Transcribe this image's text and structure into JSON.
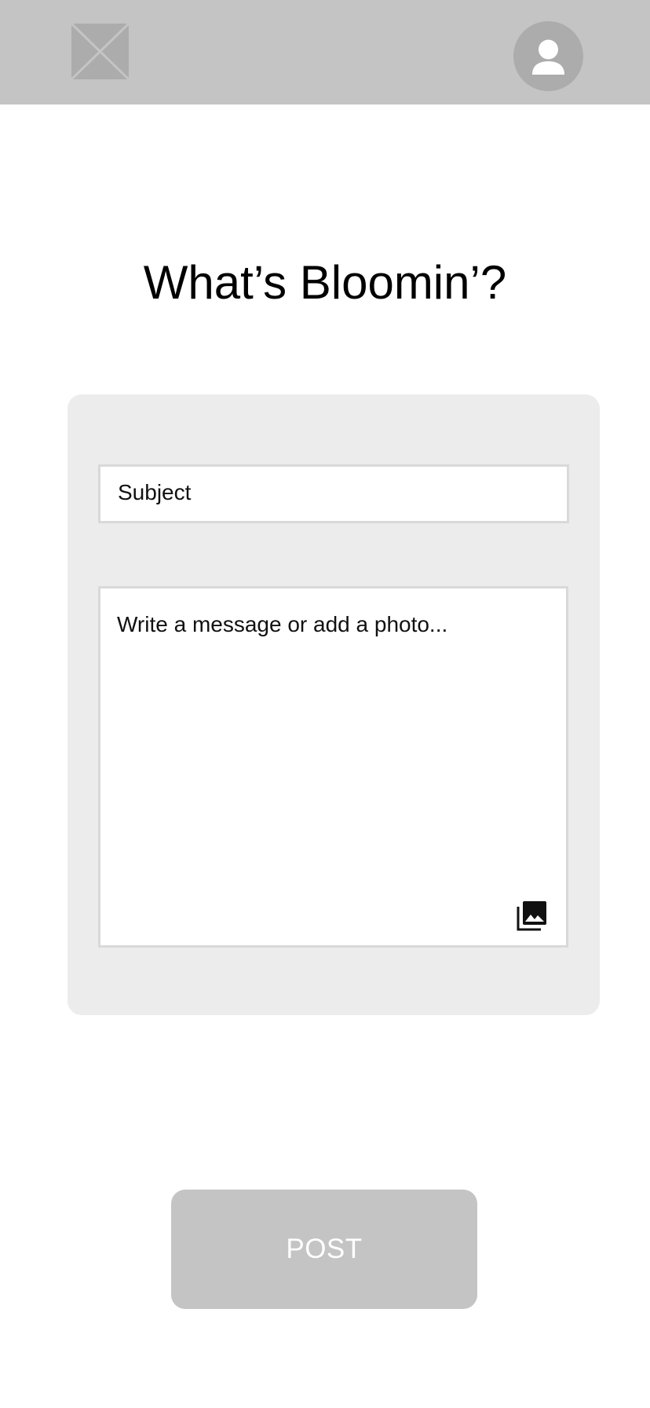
{
  "header": {
    "logo_icon": "image-placeholder-icon",
    "avatar_icon": "user-icon",
    "background_color": "#c4c4c4"
  },
  "page": {
    "title": "What’s Bloomin’?"
  },
  "form": {
    "subject": {
      "placeholder": "Subject",
      "value": ""
    },
    "message": {
      "placeholder": "Write a message or add a photo...",
      "value": ""
    },
    "photo_icon": "photo-library-icon",
    "card_color": "#ececec"
  },
  "actions": {
    "post_label": "POST",
    "post_color": "#c4c4c4"
  }
}
